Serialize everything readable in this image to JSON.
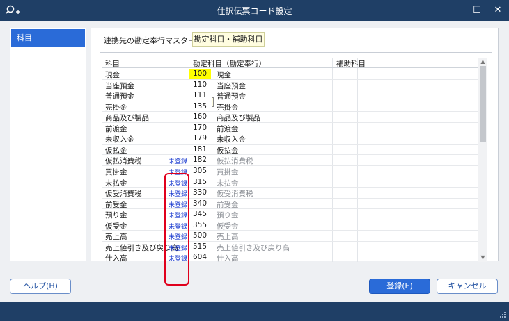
{
  "window": {
    "title": "仕訳伝票コード設定",
    "app_icon": "search-plus-icon",
    "minimize": "–",
    "maximize": "☐",
    "close": "✕"
  },
  "sidebar": {
    "items": [
      {
        "label": "科目",
        "selected": true
      }
    ]
  },
  "master": {
    "label": "連携先の勘定奉行マスター",
    "value": "勘定科目・補助科目"
  },
  "table": {
    "headers": [
      "科目",
      "勘定科目（勘定奉行）",
      "補助科目"
    ],
    "rows": [
      {
        "account": "現金",
        "status": "",
        "code": "100",
        "name": "現金"
      },
      {
        "account": "当座預金",
        "status": "",
        "code": "110",
        "name": "当座預金"
      },
      {
        "account": "普通預金",
        "status": "",
        "code": "111",
        "name": "普通預金"
      },
      {
        "account": "売掛金",
        "status": "",
        "code": "135",
        "name": "売掛金"
      },
      {
        "account": "商品及び製品",
        "status": "",
        "code": "160",
        "name": "商品及び製品"
      },
      {
        "account": "前渡金",
        "status": "",
        "code": "170",
        "name": "前渡金"
      },
      {
        "account": "未収入金",
        "status": "",
        "code": "179",
        "name": "未収入金"
      },
      {
        "account": "仮払金",
        "status": "",
        "code": "181",
        "name": "仮払金"
      },
      {
        "account": "仮払消費税",
        "status": "未登録",
        "code": "182",
        "name": "仮払消費税"
      },
      {
        "account": "買掛金",
        "status": "未登録",
        "code": "305",
        "name": "買掛金"
      },
      {
        "account": "未払金",
        "status": "未登録",
        "code": "315",
        "name": "未払金"
      },
      {
        "account": "仮受消費税",
        "status": "未登録",
        "code": "330",
        "name": "仮受消費税"
      },
      {
        "account": "前受金",
        "status": "未登録",
        "code": "340",
        "name": "前受金"
      },
      {
        "account": "預り金",
        "status": "未登録",
        "code": "345",
        "name": "預り金"
      },
      {
        "account": "仮受金",
        "status": "未登録",
        "code": "355",
        "name": "仮受金"
      },
      {
        "account": "売上高",
        "status": "未登録",
        "code": "500",
        "name": "売上高"
      },
      {
        "account": "売上値引き及び戻り高",
        "status": "未登録",
        "code": "515",
        "name": "売上値引き及び戻り高"
      },
      {
        "account": "仕入高",
        "status": "未登録",
        "code": "604",
        "name": "仕入高"
      }
    ]
  },
  "buttons": {
    "help": "ヘルプ(H)",
    "ok": "登録(E)",
    "cancel": "キャンセル"
  },
  "colors": {
    "titlebar": "#1f3f66",
    "accent": "#2a6bd8",
    "highlight": "#ffff00",
    "unregistered": "#1f3fd0",
    "annotation": "#e0001c"
  }
}
